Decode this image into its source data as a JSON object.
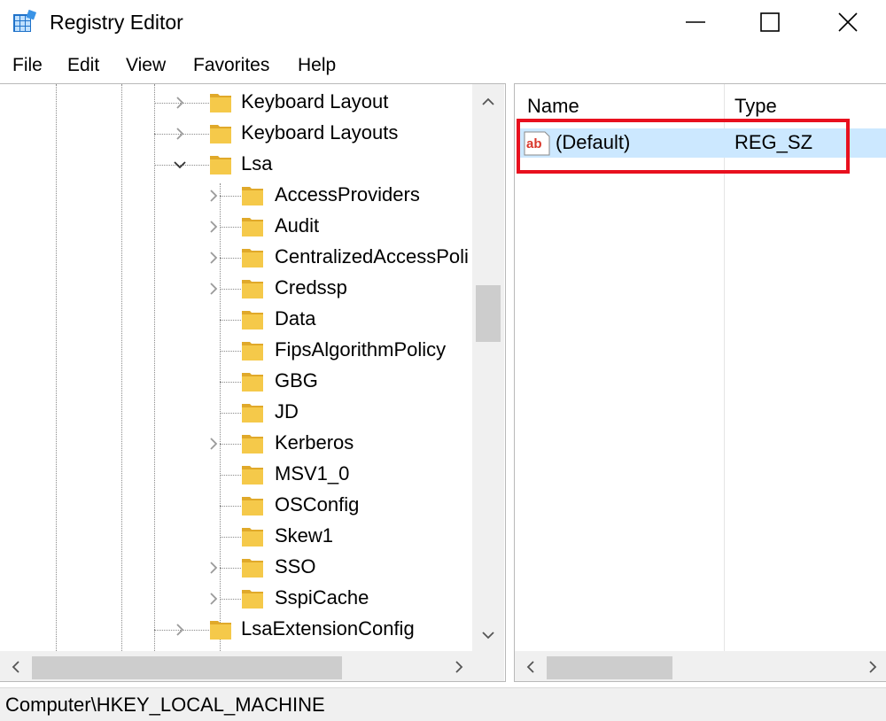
{
  "window": {
    "title": "Registry Editor"
  },
  "menu": {
    "items": [
      "File",
      "Edit",
      "View",
      "Favorites",
      "Help"
    ]
  },
  "tree": {
    "nodes": [
      {
        "label": "Keyboard Layout",
        "level": 0,
        "state": "collapsed"
      },
      {
        "label": "Keyboard Layouts",
        "level": 0,
        "state": "collapsed"
      },
      {
        "label": "Lsa",
        "level": 0,
        "state": "expanded"
      },
      {
        "label": "AccessProviders",
        "level": 1,
        "state": "collapsed"
      },
      {
        "label": "Audit",
        "level": 1,
        "state": "collapsed"
      },
      {
        "label": "CentralizedAccessPoli",
        "level": 1,
        "state": "collapsed"
      },
      {
        "label": "Credssp",
        "level": 1,
        "state": "collapsed"
      },
      {
        "label": "Data",
        "level": 1,
        "state": "leaf"
      },
      {
        "label": "FipsAlgorithmPolicy",
        "level": 1,
        "state": "leaf"
      },
      {
        "label": "GBG",
        "level": 1,
        "state": "leaf"
      },
      {
        "label": "JD",
        "level": 1,
        "state": "leaf"
      },
      {
        "label": "Kerberos",
        "level": 1,
        "state": "collapsed"
      },
      {
        "label": "MSV1_0",
        "level": 1,
        "state": "leaf"
      },
      {
        "label": "OSConfig",
        "level": 1,
        "state": "leaf"
      },
      {
        "label": "Skew1",
        "level": 1,
        "state": "leaf"
      },
      {
        "label": "SSO",
        "level": 1,
        "state": "collapsed"
      },
      {
        "label": "SspiCache",
        "level": 1,
        "state": "collapsed"
      },
      {
        "label": "LsaExtensionConfig",
        "level": 0,
        "state": "collapsed"
      }
    ]
  },
  "values": {
    "columns": {
      "name": "Name",
      "type": "Type"
    },
    "rows": [
      {
        "name": "(Default)",
        "type": "REG_SZ",
        "icon": "string-value-icon",
        "selected": true
      }
    ],
    "highlight_color": "#e8101e",
    "selection_color": "#cce8ff"
  },
  "status": {
    "path": "Computer\\HKEY_LOCAL_MACHINE"
  },
  "colors": {
    "folder": "#f5c94a",
    "folder_dark": "#e0a92a"
  }
}
